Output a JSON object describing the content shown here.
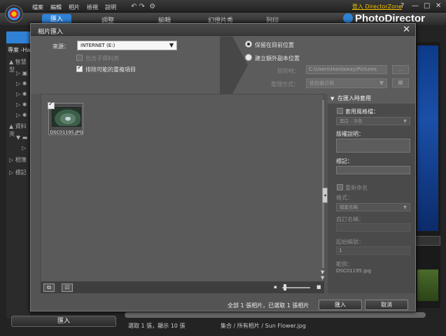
{
  "app": {
    "menu": [
      "檔案",
      "編輯",
      "相片",
      "檢視",
      "說明"
    ],
    "login_link": "登入 DirectorZone",
    "window_controls": [
      "?",
      "—",
      "□",
      "✕"
    ],
    "tabs": [
      "匯入",
      "調整",
      "編輯",
      "幻燈片秀",
      "列印"
    ],
    "brand": "PhotoDirector",
    "left_panel": {
      "project_label": "專案 -Ha",
      "smart_collection": "智慧型",
      "data": "資料夾",
      "album": "相簿",
      "tags": "標記"
    },
    "import_button": "匯入",
    "status_left": "選取 1 張，顯示 10 張",
    "status_right": "集合 / 所有相片 / Sun Flower.jpg"
  },
  "dialog": {
    "title": "相片匯入",
    "source_label": "來源：",
    "source_value": "INTERNET (E:)",
    "include_subfolders": "包含子資料夾",
    "exclude_duplicates": "排除可能的重複項目",
    "keep_location": "保留在目前位置",
    "create_copy": "建立額外副本位置",
    "destination_label": "目的地：",
    "destination_path": "C:\\Users\\Hardaway\\Pictures",
    "browse_button": "...",
    "organize_label": "整理方式：",
    "organize_value": "依拍攝日期",
    "thumbnail": {
      "filename": "DSC01195.JPG"
    },
    "side_panel": {
      "header": "在匯入時套用",
      "apply_preset": "套用風格檔：",
      "preset_value": "黑白 - 冷色",
      "copyright_label": "版權說明：",
      "tags_label": "標記：",
      "rename_label": "重新命名",
      "format_label": "格式：",
      "format_value": "檔案名稱",
      "custom_name_label": "自訂名稱：",
      "start_number_label": "起始編號：",
      "start_number_value": "1",
      "example_label": "範例：",
      "example_value": "DSC01195.jpg"
    },
    "footer": {
      "count_text": "全部 1 張相片，已選取 1 張相片",
      "import_button": "匯入",
      "cancel_button": "取消"
    }
  }
}
